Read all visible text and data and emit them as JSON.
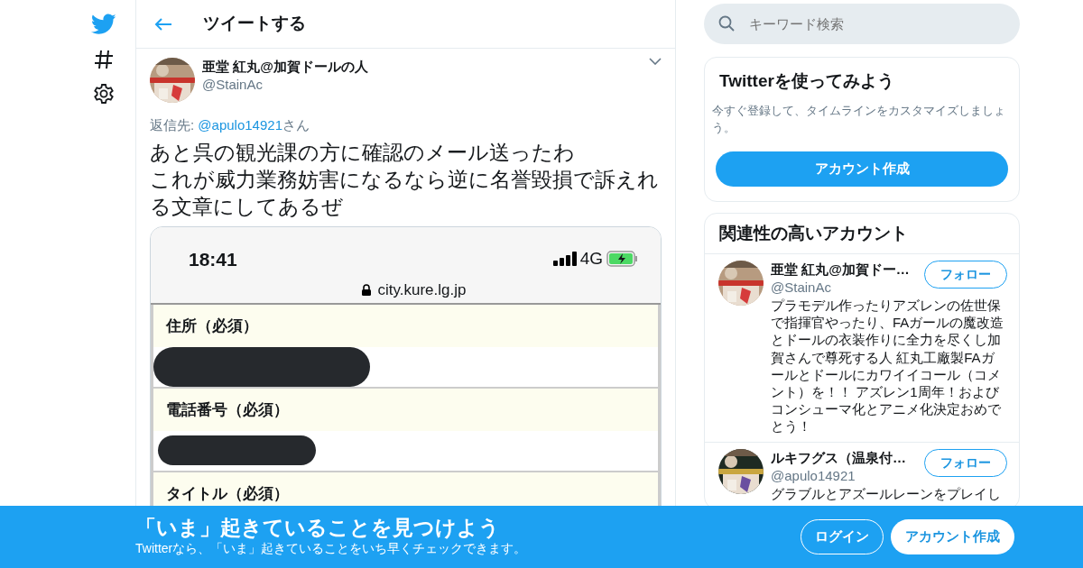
{
  "nav": {
    "items": [
      {
        "kind": "logo"
      },
      {
        "kind": "explore"
      },
      {
        "kind": "settings"
      }
    ]
  },
  "header": {
    "title": "ツイートする"
  },
  "tweet": {
    "author": {
      "name": "亜堂 紅丸@加賀ドールの人",
      "handle": "@StainAc"
    },
    "reply_to": {
      "prefix": "返信先: ",
      "handle": "@apulo14921",
      "suffix": "さん"
    },
    "text_lines": [
      "あと呉の観光課の方に確認のメール送ったわ",
      "これが威力業務妨害になるなら逆に名誉毀損で訴えれる文章にしてあるぜ"
    ],
    "attachment": {
      "time": "18:41",
      "network": "4G",
      "url": "city.kure.lg.jp",
      "form_fields": [
        {
          "label": "住所（必須）",
          "redacted": true
        },
        {
          "label": "電話番号（必須）",
          "redacted": true
        },
        {
          "label": "タイトル（必須）"
        }
      ]
    }
  },
  "search": {
    "placeholder": "キーワード検索"
  },
  "signup_card": {
    "title": "Twitterを使ってみよう",
    "description": "今すぐ登録して、タイムラインをカスタマイズしましょう。",
    "button": "アカウント作成"
  },
  "related": {
    "title": "関連性の高いアカウント",
    "accounts": [
      {
        "name": "亜堂 紅丸@加賀ドー…",
        "handle": "@StainAc",
        "button": "フォロー",
        "bio": "プラモデル作ったりアズレンの佐世保で指揮官やったり、FAガールの魔改造とドールの衣装作りに全力を尽くし加賀さんで尊死する人 紅丸工廠製FAガールとドールにカワイイコール（コメント）を！！ アズレン1周年！およびコンシューマ化とアニメ化決定おめでとう！"
      },
      {
        "name": "ルキフグス（温泉付…",
        "handle": "@apulo14921",
        "button": "フォロー",
        "bio": "グラブルとアズールレーンをプレイし"
      }
    ]
  },
  "banner": {
    "title": "「いま」起きていることを見つけよう",
    "subtitle": "Twitterなら、「いま」起きていることをいち早くチェックできます。",
    "login": "ログイン",
    "signup": "アカウント作成"
  }
}
